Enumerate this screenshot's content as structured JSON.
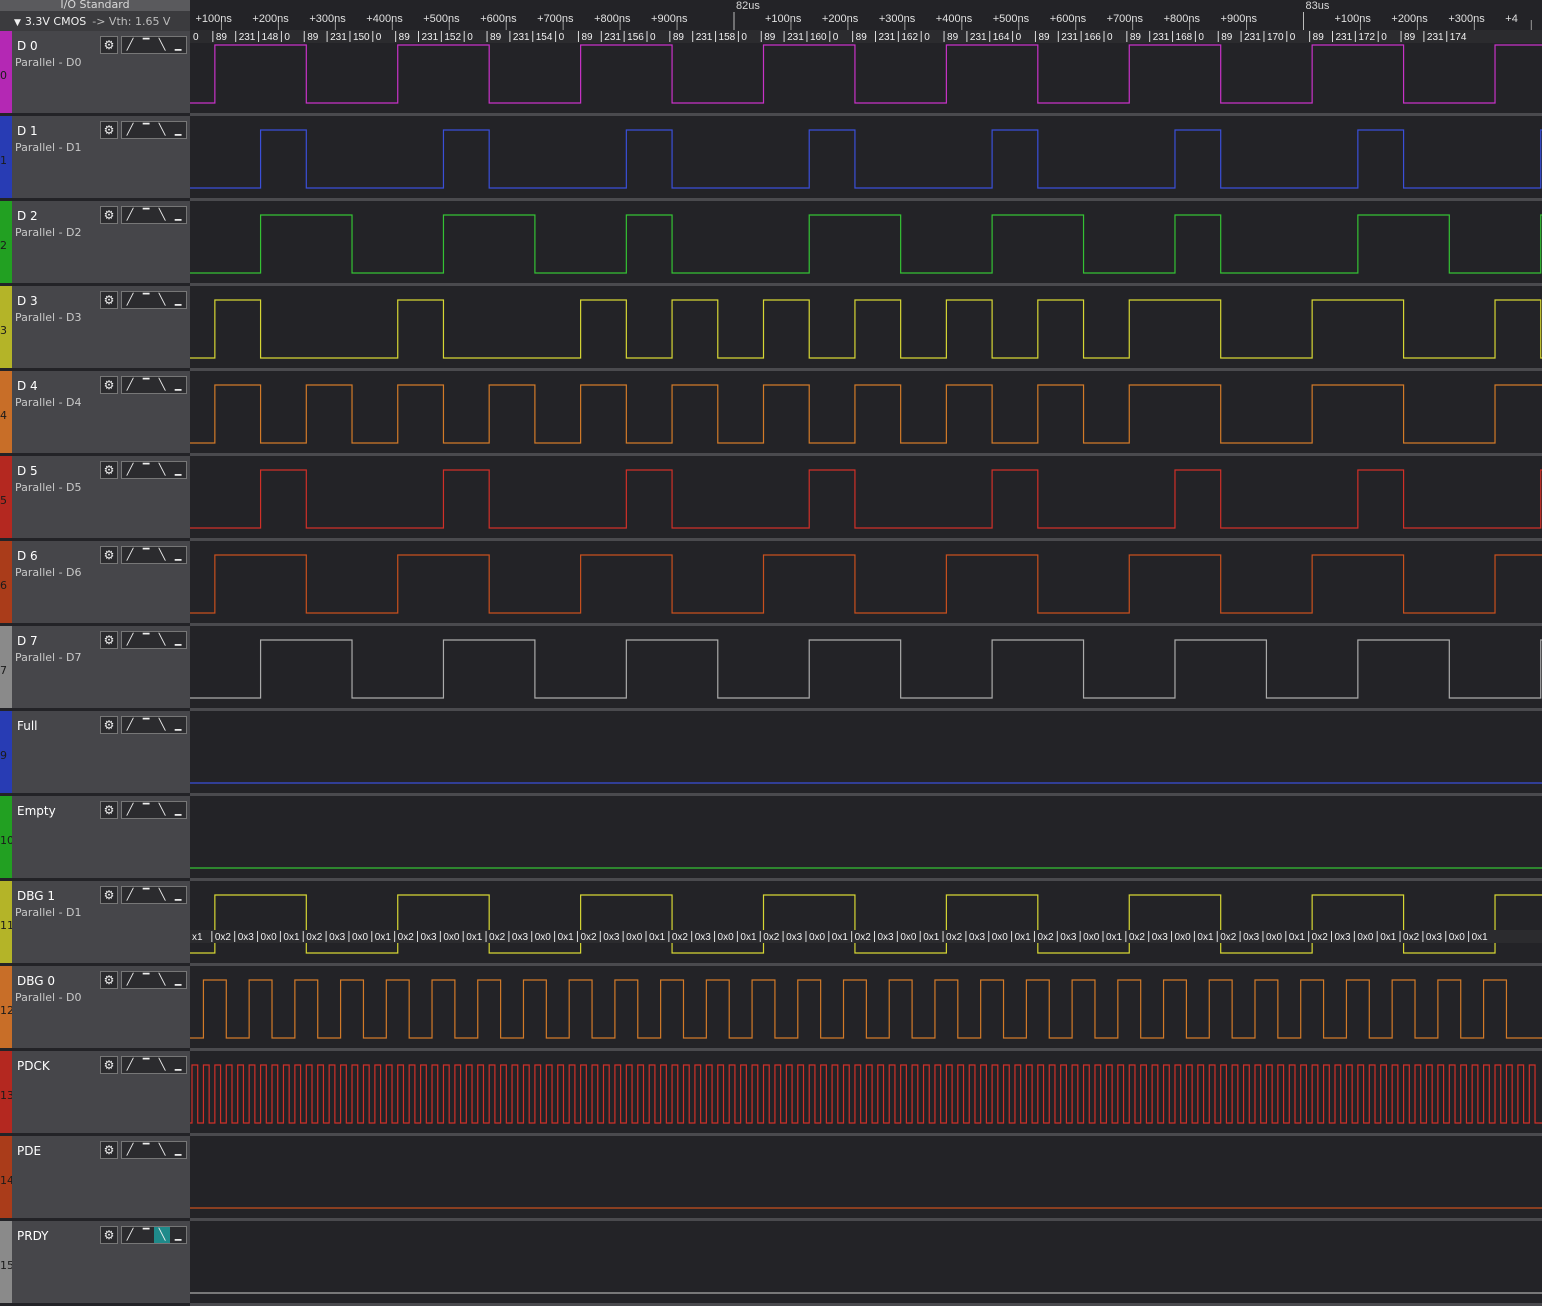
{
  "io_standard": {
    "title": "I/O Standard",
    "value": "3.3V CMOS",
    "vth": "-> Vth: 1.65 V"
  },
  "timeline": {
    "major": [
      {
        "label": "82us",
        "t_ns": 0
      },
      {
        "label": "83us",
        "t_ns": 1000
      }
    ],
    "minor": [
      {
        "label": "+100ns",
        "t_ns": -900
      },
      {
        "label": "+200ns",
        "t_ns": -800
      },
      {
        "label": "+300ns",
        "t_ns": -700
      },
      {
        "label": "+400ns",
        "t_ns": -600
      },
      {
        "label": "+500ns",
        "t_ns": -500
      },
      {
        "label": "+600ns",
        "t_ns": -400
      },
      {
        "label": "+700ns",
        "t_ns": -300
      },
      {
        "label": "+800ns",
        "t_ns": -200
      },
      {
        "label": "+900ns",
        "t_ns": -100
      },
      {
        "label": "+100ns",
        "t_ns": 100
      },
      {
        "label": "+200ns",
        "t_ns": 200
      },
      {
        "label": "+300ns",
        "t_ns": 300
      },
      {
        "label": "+400ns",
        "t_ns": 400
      },
      {
        "label": "+500ns",
        "t_ns": 500
      },
      {
        "label": "+600ns",
        "t_ns": 600
      },
      {
        "label": "+700ns",
        "t_ns": 700
      },
      {
        "label": "+800ns",
        "t_ns": 800
      },
      {
        "label": "+900ns",
        "t_ns": 900
      },
      {
        "label": "+100ns",
        "t_ns": 1100
      },
      {
        "label": "+200ns",
        "t_ns": 1200
      },
      {
        "label": "+300ns",
        "t_ns": 1300
      },
      {
        "label": "+4",
        "t_ns": 1400
      }
    ]
  },
  "trigger_icons": [
    "rising-edge-icon",
    "high-level-icon",
    "falling-edge-icon",
    "low-level-icon"
  ],
  "channels": [
    {
      "id": "d0",
      "name": "D 0",
      "sub": "Parallel - D0",
      "num": "0",
      "color": "#c832c8",
      "strip": "#b428b4",
      "start": 0,
      "edges": [
        2,
        10,
        18,
        26,
        34,
        42,
        50,
        58,
        66,
        74,
        82,
        90,
        98,
        106,
        114,
        122,
        130
      ]
    },
    {
      "id": "d1",
      "name": "D 1",
      "sub": "Parallel - D1",
      "num": "1",
      "color": "#3a4fd8",
      "strip": "#283cb4",
      "start": 0,
      "edges": [
        6,
        10,
        22,
        26,
        38,
        42,
        54,
        58,
        70,
        74,
        86,
        90,
        102,
        106,
        118,
        122,
        134
      ]
    },
    {
      "id": "d2",
      "name": "D 2",
      "sub": "Parallel - D2",
      "num": "2",
      "color": "#34c234",
      "strip": "#22a022",
      "start": 0,
      "edges": [
        6,
        14,
        22,
        30,
        38,
        42,
        54,
        62,
        70,
        78,
        86,
        90,
        102,
        110,
        118,
        122,
        134
      ]
    },
    {
      "id": "d3",
      "name": "D 3",
      "sub": "Parallel - D3",
      "num": "3",
      "color": "#d6d634",
      "strip": "#b4b428",
      "start": 0,
      "edges": [
        2,
        6,
        18,
        22,
        34,
        38,
        42,
        46,
        50,
        54,
        58,
        62,
        66,
        70,
        74,
        78,
        82,
        90,
        98,
        106,
        114,
        118,
        122,
        126,
        130,
        134
      ]
    },
    {
      "id": "d4",
      "name": "D 4",
      "sub": "Parallel - D4",
      "num": "4",
      "color": "#d27a28",
      "strip": "#c86e28",
      "start": 0,
      "edges": [
        2,
        6,
        10,
        14,
        18,
        22,
        26,
        30,
        34,
        38,
        42,
        46,
        50,
        54,
        58,
        62,
        66,
        70,
        74,
        78,
        82,
        90,
        98,
        106,
        114,
        122,
        130
      ]
    },
    {
      "id": "d5",
      "name": "D 5",
      "sub": "Parallel - D5",
      "num": "5",
      "color": "#d03028",
      "strip": "#b42820",
      "start": 0,
      "edges": [
        6,
        10,
        22,
        26,
        38,
        42,
        54,
        58,
        70,
        74,
        86,
        90,
        102,
        106,
        118,
        122,
        134
      ]
    },
    {
      "id": "d6",
      "name": "D 6",
      "sub": "Parallel - D6",
      "num": "6",
      "color": "#c8501e",
      "strip": "#aa3c1a",
      "start": 0,
      "edges": [
        2,
        10,
        18,
        26,
        34,
        42,
        50,
        58,
        66,
        74,
        82,
        90,
        98,
        106,
        114,
        122,
        130
      ]
    },
    {
      "id": "d7",
      "name": "D 7",
      "sub": "Parallel - D7",
      "num": "7",
      "color": "#aaaaaa",
      "strip": "#8a8a8a",
      "start": 0,
      "edges": [
        6,
        14,
        22,
        30,
        38,
        46,
        54,
        62,
        70,
        78,
        86,
        94,
        102,
        110,
        118,
        126,
        134
      ]
    },
    {
      "id": "full",
      "name": "Full",
      "sub": "",
      "num": "9",
      "color": "#3a4fd8",
      "strip": "#283cb4",
      "start": 0,
      "edges": []
    },
    {
      "id": "empty",
      "name": "Empty",
      "sub": "",
      "num": "10",
      "color": "#34c234",
      "strip": "#22a022",
      "start": 0,
      "edges": []
    },
    {
      "id": "dbg1",
      "name": "DBG 1",
      "sub": "Parallel - D1",
      "num": "11",
      "color": "#d6d634",
      "strip": "#b4b428",
      "start": 0,
      "edges": [
        2,
        10,
        18,
        26,
        34,
        42,
        50,
        58,
        66,
        74,
        82,
        90,
        98,
        106,
        114,
        122,
        130
      ]
    },
    {
      "id": "dbg0",
      "name": "DBG 0",
      "sub": "Parallel - D0",
      "num": "12",
      "color": "#d27a28",
      "strip": "#c86e28",
      "start": 0,
      "edges": [
        2,
        6,
        10,
        14,
        18,
        22,
        26,
        30,
        34,
        38,
        42,
        46,
        50,
        54,
        58,
        62,
        66,
        70,
        74,
        78,
        82,
        86,
        90,
        94,
        98,
        102,
        106,
        110,
        114,
        118,
        122,
        126,
        130,
        134,
        138,
        142,
        146,
        150,
        154,
        158,
        162,
        166,
        170,
        174,
        178,
        182,
        186,
        190,
        194,
        198,
        202,
        206,
        210,
        214,
        218,
        222,
        226,
        230
      ]
    },
    {
      "id": "pdck",
      "name": "PDCK",
      "sub": "",
      "num": "13",
      "color": "#d03028",
      "strip": "#b42820",
      "start": 0,
      "edges": [
        0,
        1,
        2,
        3,
        4,
        5,
        6,
        7,
        8,
        9,
        10,
        11,
        12,
        13,
        14,
        15,
        16,
        17,
        18,
        19,
        20,
        21,
        22,
        23,
        24,
        25,
        26,
        27,
        28,
        29,
        30,
        31,
        32,
        33,
        34,
        35,
        36,
        37,
        38,
        39,
        40,
        41,
        42,
        43,
        44,
        45,
        46,
        47,
        48,
        49,
        50,
        51,
        52,
        53,
        54,
        55,
        56,
        57,
        58,
        59,
        60,
        61,
        62,
        63,
        64,
        65,
        66,
        67,
        68,
        69,
        70,
        71,
        72,
        73,
        74,
        75,
        76,
        77,
        78,
        79,
        80,
        81,
        82,
        83,
        84,
        85,
        86,
        87,
        88,
        89,
        90,
        91,
        92,
        93,
        94,
        95,
        96,
        97,
        98,
        99,
        100,
        101,
        102,
        103,
        104,
        105,
        106,
        107,
        108,
        109,
        110,
        111,
        112,
        113,
        114,
        115,
        116,
        117,
        118,
        119,
        120,
        121,
        122,
        123,
        124,
        125,
        126,
        127,
        128,
        129,
        130,
        131,
        132,
        133,
        134,
        135,
        136,
        137,
        138,
        139,
        140,
        141,
        142,
        143,
        144,
        145,
        146,
        147,
        148,
        149,
        150,
        151,
        152,
        153,
        154,
        155,
        156,
        157,
        158,
        159,
        160,
        161,
        162,
        163,
        164,
        165,
        166,
        167,
        168,
        169,
        170,
        171,
        172,
        173,
        174,
        175,
        176,
        177,
        178,
        179,
        180,
        181,
        182,
        183,
        184,
        185,
        186,
        187,
        188,
        189,
        190,
        191,
        192,
        193,
        194,
        195,
        196,
        197,
        198,
        199,
        200,
        201,
        202,
        203,
        204,
        205,
        206,
        207,
        208,
        209,
        210,
        211,
        212,
        213,
        214,
        215,
        216,
        217,
        218,
        219,
        220,
        221,
        222,
        223,
        224,
        225,
        226,
        227,
        228,
        229,
        230,
        231,
        232,
        233,
        234,
        235
      ]
    },
    {
      "id": "pde",
      "name": "PDE",
      "sub": "",
      "num": "14",
      "color": "#c8501e",
      "strip": "#aa3c1a",
      "start": 0,
      "edges": [
        137
      ]
    },
    {
      "id": "prdy",
      "name": "PRDY",
      "sub": "",
      "num": "15",
      "color": "#aaaaaa",
      "strip": "#8a8a8a",
      "start": 0,
      "edges": [
        136
      ],
      "selected_trigger": 2
    }
  ],
  "decode": {
    "parallel": [
      "0",
      "89",
      "231",
      "148",
      "0",
      "89",
      "231",
      "150",
      "0",
      "89",
      "231",
      "152",
      "0",
      "89",
      "231",
      "154",
      "0",
      "89",
      "231",
      "156",
      "0",
      "89",
      "231",
      "158",
      "0",
      "89",
      "231",
      "160",
      "0",
      "89",
      "231",
      "162",
      "0",
      "89",
      "231",
      "164",
      "0",
      "89",
      "231",
      "166",
      "0",
      "89",
      "231",
      "168",
      "0",
      "89",
      "231",
      "170",
      "0",
      "89",
      "231",
      "172",
      "0",
      "89",
      "231",
      "174"
    ],
    "dbg": [
      "x1",
      "0x2",
      "0x3",
      "0x0",
      "0x1",
      "0x2",
      "0x3",
      "0x0",
      "0x1",
      "0x2",
      "0x3",
      "0x0",
      "0x1",
      "0x2",
      "0x3",
      "0x0",
      "0x1",
      "0x2",
      "0x3",
      "0x0",
      "0x1",
      "0x2",
      "0x3",
      "0x0",
      "0x1",
      "0x2",
      "0x3",
      "0x0",
      "0x1",
      "0x2",
      "0x3",
      "0x0",
      "0x1",
      "0x2",
      "0x3",
      "0x0",
      "0x1",
      "0x2",
      "0x3",
      "0x0",
      "0x1",
      "0x2",
      "0x3",
      "0x0",
      "0x1",
      "0x2",
      "0x3",
      "0x0",
      "0x1",
      "0x2",
      "0x3",
      "0x0",
      "0x1",
      "0x2",
      "0x3",
      "0x0",
      "0x1"
    ]
  }
}
